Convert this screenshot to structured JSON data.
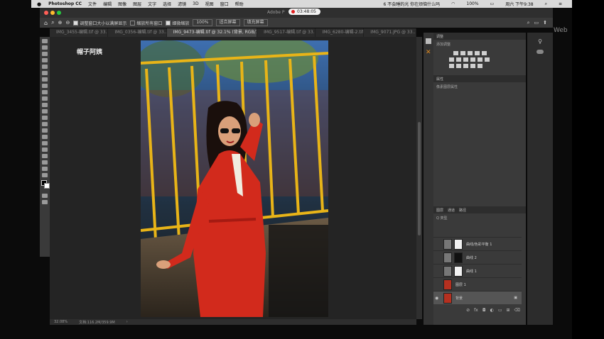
{
  "menubar": {
    "app_name": "Photoshop CC",
    "menus": [
      "文件",
      "编辑",
      "图像",
      "图层",
      "文字",
      "选择",
      "滤镜",
      "3D",
      "视图",
      "窗口",
      "帮助"
    ],
    "now_playing": "6 不会睡的光  你在烦恼什么吗",
    "battery": "100%",
    "datetime": "周六 下午9:38"
  },
  "window": {
    "title": "Adobe P",
    "recording_time": "03:48:05"
  },
  "options_bar": {
    "resize_windows_label": "调整窗口大小以满屏显示",
    "zoom_all_label": "缩放所有窗口",
    "scrubby_zoom_label": "细微缩放",
    "zoom_value": "100%",
    "fit_screen_label": "适合屏幕",
    "fill_screen_label": "填充屏幕"
  },
  "tabs": [
    {
      "label": "IMG_3455-编辑.tif @ 33...",
      "active": false
    },
    {
      "label": "IMG_0356-编辑.tif @ 33...",
      "active": false
    },
    {
      "label": "IMG_9473-编辑.tif @ 32.1% (背景, RGB/16*)",
      "active": true
    },
    {
      "label": "IMG_9517-编辑.tif @ 33...",
      "active": false
    },
    {
      "label": "IMG_6280-编辑-2.tif",
      "active": false
    },
    {
      "label": "IMG_9071.JPG @ 33...",
      "active": false
    }
  ],
  "canvas": {
    "watermark": "帽子阿姨"
  },
  "status_bar": {
    "zoom": "32.08%",
    "doc_size": "文档:116.2M/359.9M"
  },
  "panels": {
    "adjustments_tab": "调整",
    "add_adjustment_label": "添加调整",
    "properties_tab": "属性",
    "pixel_layer_label": "像素图层属性",
    "layers_tabs": [
      "图层",
      "通道",
      "路径"
    ],
    "kind_filter": "Q 类型",
    "layers": [
      {
        "name": "曲线/色彩平衡 1"
      },
      {
        "name": "曲线 2"
      },
      {
        "name": "曲线 1"
      },
      {
        "name": "图层 1"
      },
      {
        "name": "背景"
      }
    ]
  },
  "right_edge_text": "Web",
  "colors": {
    "ps_panel": "#3a3a3a",
    "ps_canvas": "#242424",
    "rec_red": "#e02020"
  }
}
